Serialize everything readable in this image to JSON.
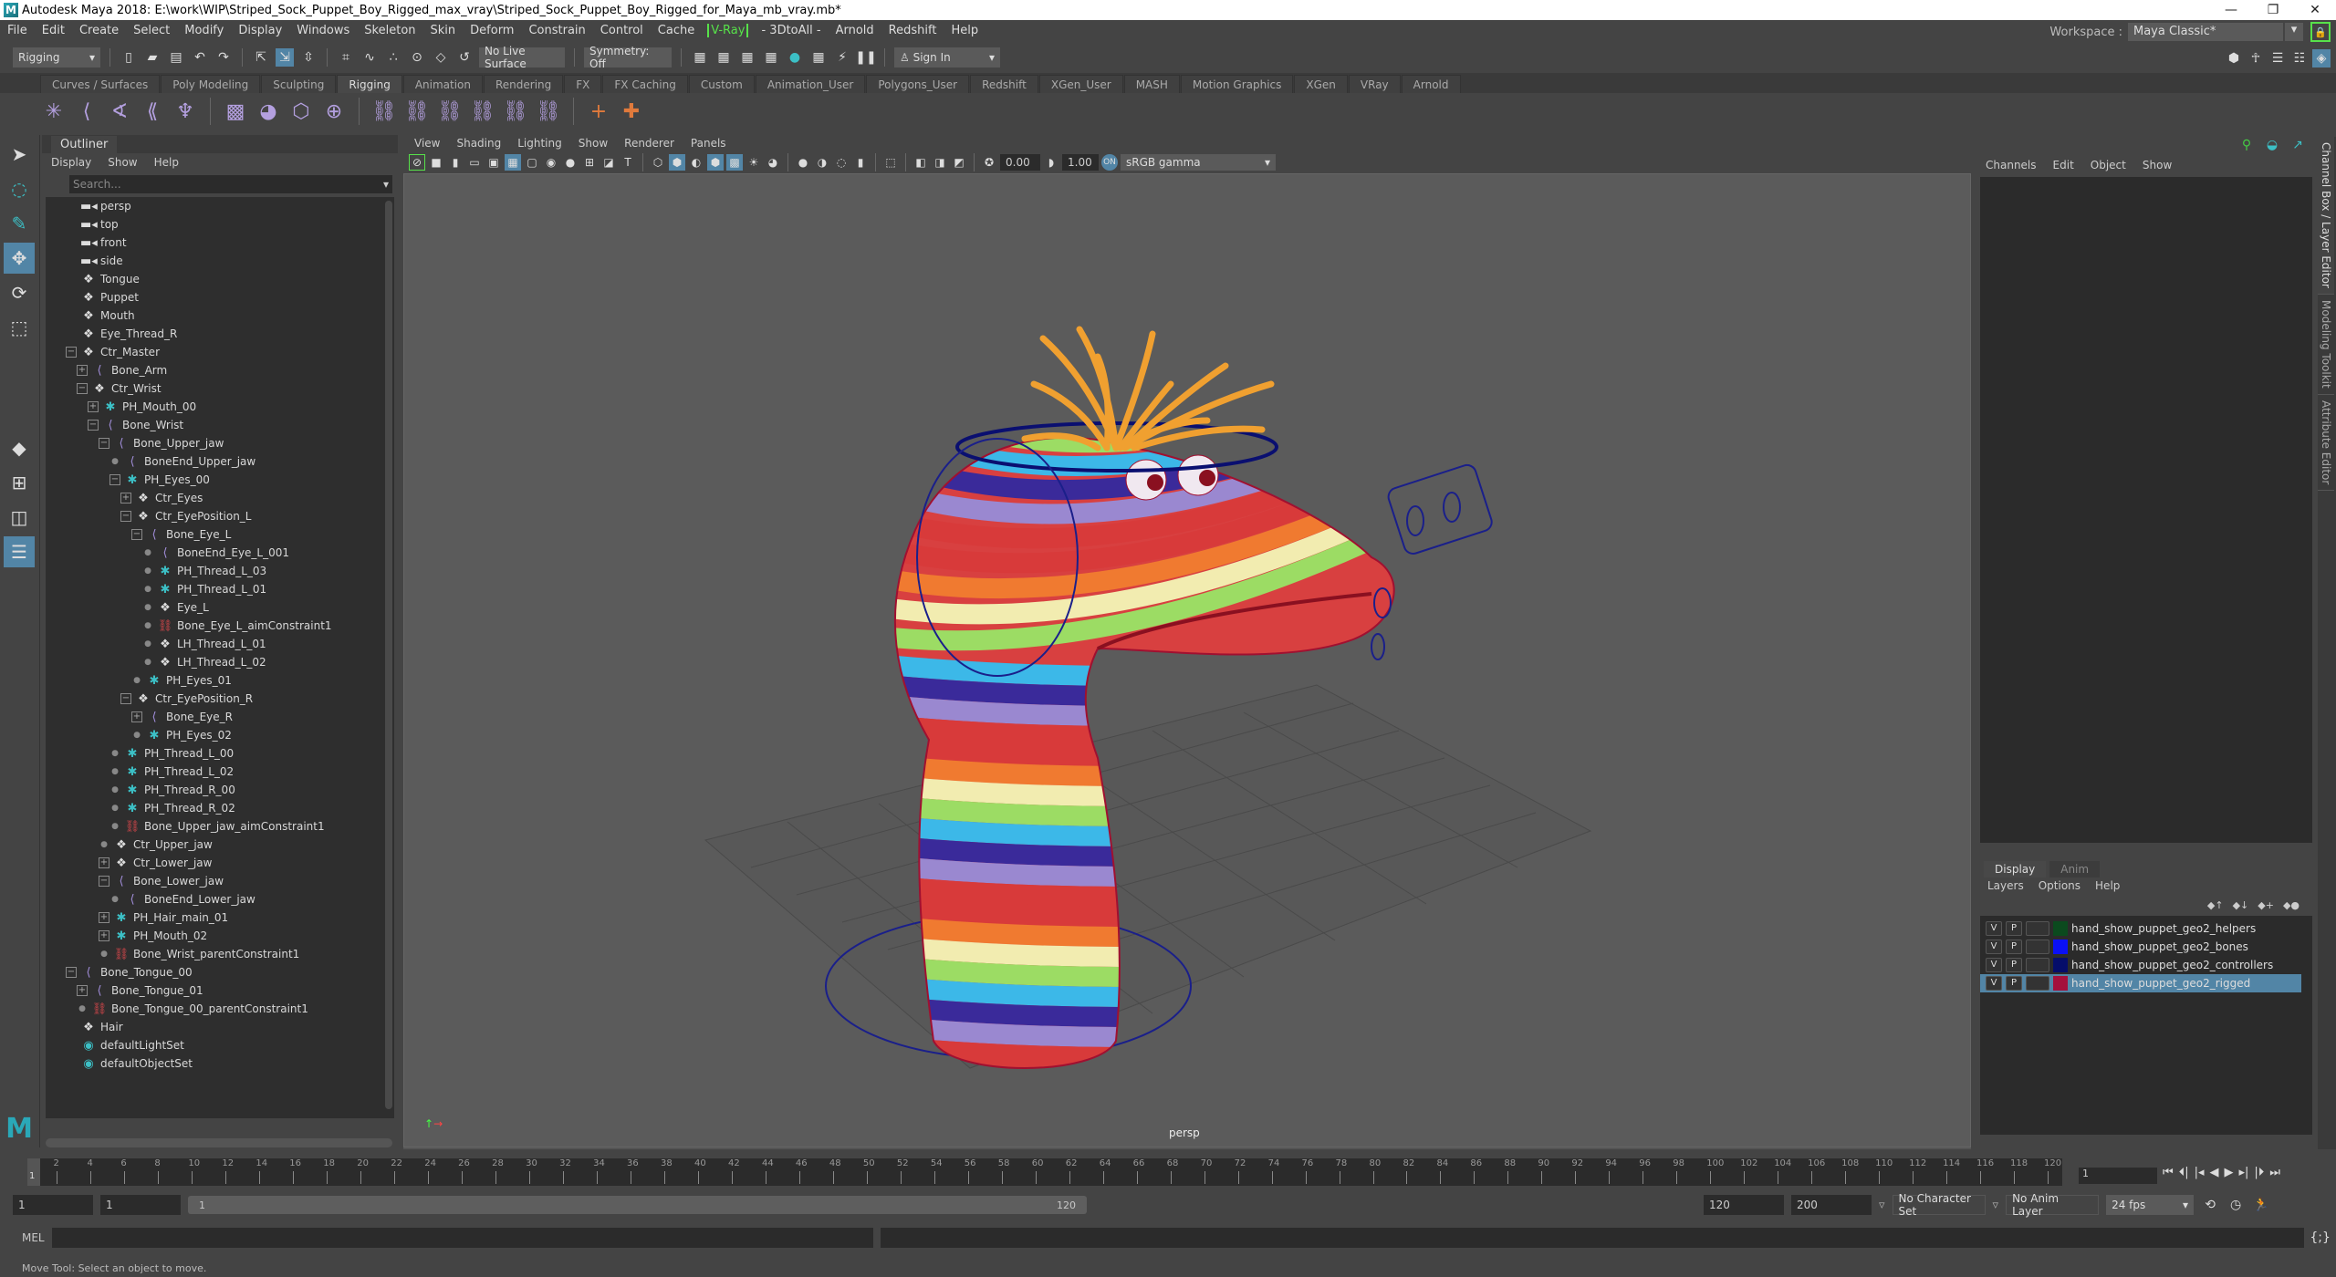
{
  "window": {
    "title": "Autodesk Maya 2018: E:\\work\\WIP\\Striped_Sock_Puppet_Boy_Rigged_max_vray\\Striped_Sock_Puppet_Boy_Rigged_for_Maya_mb_vray.mb*",
    "logo": "M",
    "controls": {
      "minimize": "—",
      "restore": "❐",
      "close": "✕"
    }
  },
  "menubar": [
    "File",
    "Edit",
    "Create",
    "Select",
    "Modify",
    "Display",
    "Windows",
    "Skeleton",
    "Skin",
    "Deform",
    "Constrain",
    "Control",
    "Cache",
    "V-Ray",
    "- 3DtoAll -",
    "Arnold",
    "Redshift",
    "Help"
  ],
  "workspace": {
    "label": "Workspace :",
    "value": "Maya Classic*"
  },
  "statusline": {
    "menuset": "Rigging",
    "live_surface": "No Live Surface",
    "symmetry": "Symmetry: Off",
    "sign_in": "Sign In"
  },
  "shelf": {
    "tabs": [
      "Curves / Surfaces",
      "Poly Modeling",
      "Sculpting",
      "Rigging",
      "Animation",
      "Rendering",
      "FX",
      "FX Caching",
      "Custom",
      "Animation_User",
      "Polygons_User",
      "Redshift",
      "XGen_User",
      "MASH",
      "Motion Graphics",
      "XGen",
      "VRay",
      "Arnold"
    ],
    "active_tab": "Rigging"
  },
  "outliner": {
    "title": "Outliner",
    "menu": [
      "Display",
      "Show",
      "Help"
    ],
    "search_placeholder": "Search...",
    "items": [
      {
        "label": "persp",
        "icon": "camera",
        "depth": 0,
        "toggle": ""
      },
      {
        "label": "top",
        "icon": "camera",
        "depth": 0,
        "toggle": ""
      },
      {
        "label": "front",
        "icon": "camera",
        "depth": 0,
        "toggle": ""
      },
      {
        "label": "side",
        "icon": "camera",
        "depth": 0,
        "toggle": ""
      },
      {
        "label": "Tongue",
        "icon": "transform",
        "depth": 0,
        "toggle": ""
      },
      {
        "label": "Puppet",
        "icon": "transform",
        "depth": 0,
        "toggle": ""
      },
      {
        "label": "Mouth",
        "icon": "transform",
        "depth": 0,
        "toggle": ""
      },
      {
        "label": "Eye_Thread_R",
        "icon": "transform",
        "depth": 0,
        "toggle": ""
      },
      {
        "label": "Ctr_Master",
        "icon": "transform",
        "depth": 0,
        "toggle": "minus"
      },
      {
        "label": "Bone_Arm",
        "icon": "bone",
        "depth": 1,
        "toggle": "plus"
      },
      {
        "label": "Ctr_Wrist",
        "icon": "transform",
        "depth": 1,
        "toggle": "minus"
      },
      {
        "label": "PH_Mouth_00",
        "icon": "locator",
        "depth": 2,
        "toggle": "plus"
      },
      {
        "label": "Bone_Wrist",
        "icon": "bone",
        "depth": 2,
        "toggle": "minus"
      },
      {
        "label": "Bone_Upper_jaw",
        "icon": "bone",
        "depth": 3,
        "toggle": "minus"
      },
      {
        "label": "BoneEnd_Upper_jaw",
        "icon": "bone",
        "depth": 4,
        "toggle": "dot"
      },
      {
        "label": "PH_Eyes_00",
        "icon": "locator",
        "depth": 4,
        "toggle": "minus"
      },
      {
        "label": "Ctr_Eyes",
        "icon": "transform",
        "depth": 5,
        "toggle": "plus"
      },
      {
        "label": "Ctr_EyePosition_L",
        "icon": "transform",
        "depth": 5,
        "toggle": "minus"
      },
      {
        "label": "Bone_Eye_L",
        "icon": "bone",
        "depth": 6,
        "toggle": "minus"
      },
      {
        "label": "BoneEnd_Eye_L_001",
        "icon": "bone",
        "depth": 7,
        "toggle": "dot"
      },
      {
        "label": "PH_Thread_L_03",
        "icon": "locator",
        "depth": 7,
        "toggle": "dot"
      },
      {
        "label": "PH_Thread_L_01",
        "icon": "locator",
        "depth": 7,
        "toggle": "dot"
      },
      {
        "label": "Eye_L",
        "icon": "transform",
        "depth": 7,
        "toggle": "dot"
      },
      {
        "label": "Bone_Eye_L_aimConstraint1",
        "icon": "constraint",
        "depth": 7,
        "toggle": "dot"
      },
      {
        "label": "LH_Thread_L_01",
        "icon": "transform",
        "depth": 7,
        "toggle": "dot"
      },
      {
        "label": "LH_Thread_L_02",
        "icon": "transform",
        "depth": 7,
        "toggle": "dot"
      },
      {
        "label": "PH_Eyes_01",
        "icon": "locator",
        "depth": 6,
        "toggle": "dot"
      },
      {
        "label": "Ctr_EyePosition_R",
        "icon": "transform",
        "depth": 5,
        "toggle": "minus"
      },
      {
        "label": "Bone_Eye_R",
        "icon": "bone",
        "depth": 6,
        "toggle": "plus"
      },
      {
        "label": "PH_Eyes_02",
        "icon": "locator",
        "depth": 6,
        "toggle": "dot"
      },
      {
        "label": "PH_Thread_L_00",
        "icon": "locator",
        "depth": 4,
        "toggle": "dot"
      },
      {
        "label": "PH_Thread_L_02",
        "icon": "locator",
        "depth": 4,
        "toggle": "dot"
      },
      {
        "label": "PH_Thread_R_00",
        "icon": "locator",
        "depth": 4,
        "toggle": "dot"
      },
      {
        "label": "PH_Thread_R_02",
        "icon": "locator",
        "depth": 4,
        "toggle": "dot"
      },
      {
        "label": "Bone_Upper_jaw_aimConstraint1",
        "icon": "constraint",
        "depth": 4,
        "toggle": "dot"
      },
      {
        "label": "Ctr_Upper_jaw",
        "icon": "transform",
        "depth": 3,
        "toggle": "dot"
      },
      {
        "label": "Ctr_Lower_jaw",
        "icon": "transform",
        "depth": 3,
        "toggle": "plus"
      },
      {
        "label": "Bone_Lower_jaw",
        "icon": "bone",
        "depth": 3,
        "toggle": "minus"
      },
      {
        "label": "BoneEnd_Lower_jaw",
        "icon": "bone",
        "depth": 4,
        "toggle": "dot"
      },
      {
        "label": "PH_Hair_main_01",
        "icon": "locator",
        "depth": 3,
        "toggle": "plus"
      },
      {
        "label": "PH_Mouth_02",
        "icon": "locator",
        "depth": 3,
        "toggle": "plus"
      },
      {
        "label": "Bone_Wrist_parentConstraint1",
        "icon": "constraint",
        "depth": 3,
        "toggle": "dot"
      },
      {
        "label": "Bone_Tongue_00",
        "icon": "bone",
        "depth": 0,
        "toggle": "minus"
      },
      {
        "label": "Bone_Tongue_01",
        "icon": "bone",
        "depth": 1,
        "toggle": "plus"
      },
      {
        "label": "Bone_Tongue_00_parentConstraint1",
        "icon": "constraint",
        "depth": 1,
        "toggle": "dot"
      },
      {
        "label": "Hair",
        "icon": "transform",
        "depth": 0,
        "toggle": ""
      },
      {
        "label": "defaultLightSet",
        "icon": "set",
        "depth": 0,
        "toggle": ""
      },
      {
        "label": "defaultObjectSet",
        "icon": "set",
        "depth": 0,
        "toggle": ""
      }
    ]
  },
  "viewport": {
    "menu": [
      "View",
      "Shading",
      "Lighting",
      "Show",
      "Renderer",
      "Panels"
    ],
    "exposure": "0.00",
    "gamma": "1.00",
    "color_space": "sRGB gamma",
    "camera_label": "persp"
  },
  "channelbox": {
    "menu": [
      "Channels",
      "Edit",
      "Object",
      "Show"
    ]
  },
  "sidetabs": [
    "Channel Box / Layer Editor",
    "Modeling Toolkit",
    "Attribute Editor"
  ],
  "layers": {
    "tabs": [
      "Display",
      "Anim"
    ],
    "active_tab": "Display",
    "menu": [
      "Layers",
      "Options",
      "Help"
    ],
    "items": [
      {
        "v": "V",
        "p": "P",
        "name": "hand_show_puppet_geo2_helpers",
        "color": "#0b4a1e",
        "selected": false
      },
      {
        "v": "V",
        "p": "P",
        "name": "hand_show_puppet_geo2_bones",
        "color": "#0a10f5",
        "selected": false
      },
      {
        "v": "V",
        "p": "P",
        "name": "hand_show_puppet_geo2_controllers",
        "color": "#050d6a",
        "selected": false
      },
      {
        "v": "V",
        "p": "P",
        "name": "hand_show_puppet_geo2_rigged",
        "color": "#a4103c",
        "selected": true
      }
    ]
  },
  "timeline": {
    "ticks": [
      "2",
      "4",
      "6",
      "8",
      "10",
      "12",
      "14",
      "16",
      "18",
      "20",
      "22",
      "24",
      "26",
      "28",
      "30",
      "32",
      "34",
      "36",
      "38",
      "40",
      "42",
      "44",
      "46",
      "48",
      "50",
      "52",
      "54",
      "56",
      "58",
      "60",
      "62",
      "64",
      "66",
      "68",
      "70",
      "72",
      "74",
      "76",
      "78",
      "80",
      "82",
      "84",
      "86",
      "88",
      "90",
      "92",
      "94",
      "96",
      "98",
      "100",
      "102",
      "104",
      "106",
      "108",
      "110",
      "112",
      "114",
      "116",
      "118",
      "120"
    ],
    "current_marker": "1",
    "current_frame": "1"
  },
  "range": {
    "start": "1",
    "playback_start": "1",
    "slider_start": "1",
    "slider_end": "120",
    "playback_end": "120",
    "end": "200",
    "character_set": "No Character Set",
    "anim_layer": "No Anim Layer",
    "fps": "24 fps"
  },
  "cmdline": {
    "label": "MEL"
  },
  "helpline": "Move Tool: Select an object to move."
}
